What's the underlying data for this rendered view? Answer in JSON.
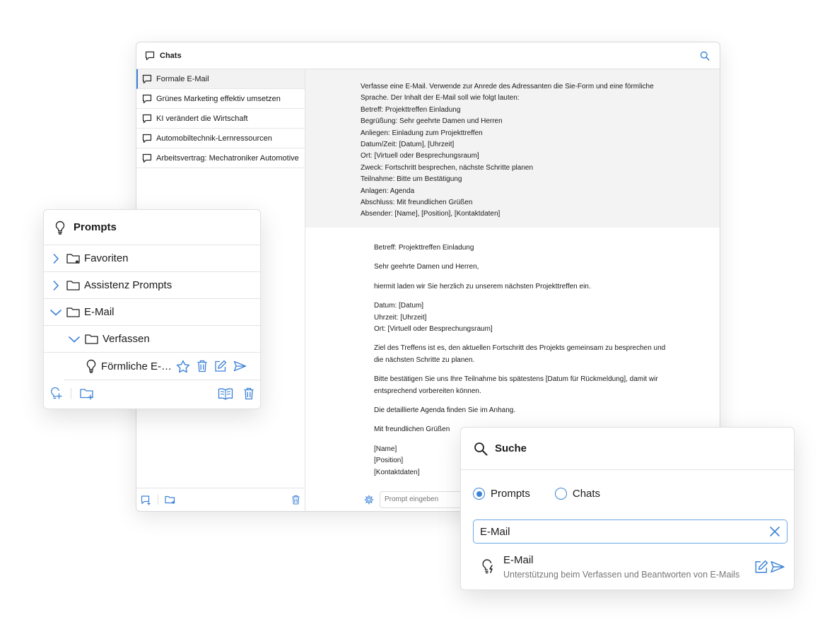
{
  "chats_window": {
    "title": "Chats",
    "chat_list": [
      {
        "label": "Formale E-Mail"
      },
      {
        "label": "Grünes Marketing effektiv umsetzen"
      },
      {
        "label": "KI verändert die Wirtschaft"
      },
      {
        "label": "Automobiltechnik-Lernressourcen"
      },
      {
        "label": "Arbeitsvertrag: Mechatroniker Automotive"
      }
    ],
    "user_message": [
      "Verfasse eine E-Mail. Verwende zur Anrede des Adressanten die Sie-Form und eine förmliche",
      "Sprache. Der Inhalt der E-Mail soll wie folgt lauten:",
      "Betreff: Projekttreffen Einladung",
      "Begrüßung: Sehr geehrte Damen und Herren",
      "Anliegen: Einladung zum Projekttreffen",
      "Datum/Zeit: [Datum], [Uhrzeit]",
      "Ort: [Virtuell oder Besprechungsraum]",
      "Zweck: Fortschritt besprechen, nächste Schritte planen",
      "Teilnahme: Bitte um Bestätigung",
      "Anlagen: Agenda",
      "Abschluss: Mit freundlichen Grüßen",
      "Absender: [Name], [Position], [Kontaktdaten]"
    ],
    "assistant_message": [
      [
        "Betreff: Projekttreffen Einladung"
      ],
      [
        "Sehr geehrte Damen und Herren,"
      ],
      [
        "hiermit laden wir Sie herzlich zu unserem nächsten Projekttreffen ein."
      ],
      [
        "Datum: [Datum]",
        "Uhrzeit: [Uhrzeit]",
        "Ort: [Virtuell oder Besprechungsraum]"
      ],
      [
        "Ziel des Treffens ist es, den aktuellen Fortschritt des Projekts gemeinsam zu besprechen und",
        "die nächsten Schritte zu planen."
      ],
      [
        "Bitte bestätigen Sie uns Ihre Teilnahme bis spätestens [Datum für Rückmeldung], damit wir",
        "entsprechend vorbereiten können."
      ],
      [
        "Die detaillierte Agenda finden Sie im Anhang."
      ],
      [
        "Mit freundlichen Grüßen"
      ],
      [
        "[Name]",
        "[Position]",
        "[Kontaktdaten]"
      ]
    ],
    "prompt_placeholder": "Prompt eingeben"
  },
  "prompts_panel": {
    "title": "Prompts",
    "folders": {
      "favoriten": "Favoriten",
      "assistenz": "Assistenz Prompts",
      "email": "E-Mail",
      "verfassen": "Verfassen"
    },
    "prompt_item": "Förmliche E-Mail"
  },
  "search_panel": {
    "title": "Suche",
    "radio_prompts": "Prompts",
    "radio_chats": "Chats",
    "query": "E-Mail",
    "result_title": "E-Mail",
    "result_description": "Unterstützung beim Verfassen und Beantworten von E-Mails"
  },
  "colors": {
    "accent": "#3b82d6",
    "text": "#1a1a1a",
    "muted": "#777777"
  }
}
